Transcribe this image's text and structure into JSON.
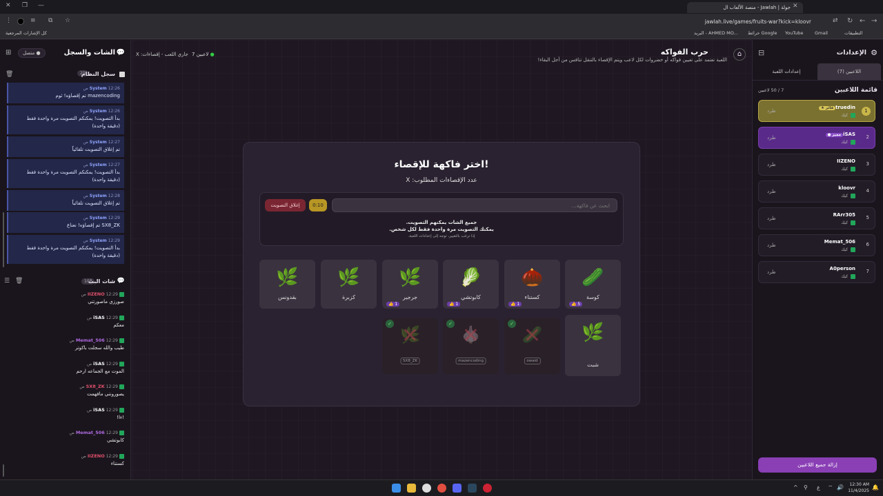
{
  "browser": {
    "tab_title": "جولة | Jawlah - منصة الألعاب ال",
    "url": "jawlah.live/games/fruits-war?kick=kloovr",
    "bookmarks": [
      "التطبيقات",
      "Gmail",
      "YouTube",
      "خرائط Google",
      "البريد - AHMED MO...",
      "كل الإشارات المرجعية"
    ]
  },
  "chat_panel": {
    "title": "الشات والسجل",
    "status": "متصل",
    "system_log": {
      "title": "سجل النظام",
      "count": "25",
      "messages": [
        {
          "sender": "System",
          "time": "12:26 ص",
          "text": "mazencoding تم إقصاؤه! ثوم"
        },
        {
          "sender": "System",
          "time": "12:26 ص",
          "text": "بدأ التصويت! يمكنكم التصويت مرة واحدة فقط (دقيقة واحدة)"
        },
        {
          "sender": "System",
          "time": "12:27 ص",
          "text": "تم إغلاق التصويت تلقائياً"
        },
        {
          "sender": "System",
          "time": "12:27 ص",
          "text": "بدأ التصويت! يمكنكم التصويت مرة واحدة فقط (دقيقة واحدة)"
        },
        {
          "sender": "System",
          "time": "12:28 ص",
          "text": "تم إغلاق التصويت تلقائياً"
        },
        {
          "sender": "System",
          "time": "12:29 ص",
          "text": "SX8_ZK تم إقصاؤه! نعناع"
        },
        {
          "sender": "System",
          "time": "12:29 ص",
          "text": "بدأ التصويت! يمكنكم التصويت مرة واحدة فقط (دقيقة واحدة)"
        }
      ]
    },
    "live_chat": {
      "title": "شات البث",
      "count": "107",
      "messages": [
        {
          "user": "IIZENO",
          "color": "#e0506a",
          "time": "12:29 ص",
          "text": "صورزي ماصورتني"
        },
        {
          "user": "iSAS",
          "color": "#ffffff",
          "time": "12:29 ص",
          "text": "معكم"
        },
        {
          "user": "Memat_506",
          "color": "#b06ae0",
          "time": "12:29 ص",
          "text": "طيب والله سجلت باكوتر"
        },
        {
          "user": "iSAS",
          "color": "#ffffff",
          "time": "12:29 ص",
          "text": "الموت مع الجماعه ارحم"
        },
        {
          "user": "SX8_ZK",
          "color": "#e0506a",
          "time": "12:29 ص",
          "text": "يصورونني مافهمت"
        },
        {
          "user": "iSAS",
          "color": "#ffffff",
          "time": "12:29 ص",
          "text": "!ءا!"
        },
        {
          "user": "Memat_506",
          "color": "#b06ae0",
          "time": "12:29 ص",
          "text": "كابوتشي"
        },
        {
          "user": "IIZENO",
          "color": "#e0506a",
          "time": "12:29 ص",
          "text": "كستناء"
        }
      ]
    }
  },
  "header": {
    "title": "حرب الفواكه",
    "description": "اللعبة تعتمد على تعيين فواكه أو خضروات لكل لاعب ويتم الإقصاء بالتنقل تنافس من أجل البقاء!",
    "players_badge": "7 لاعبين",
    "status": "جاري اللعب - إقصاءات: X"
  },
  "game": {
    "title": "اختر فاكهة للإقصاء!",
    "required": "عدد الإقصاءات المطلوب: X",
    "search_placeholder": "ابحث عن فاكهة...",
    "timer": "0:10",
    "close_vote": "إغلاق التصويت",
    "info_line1": "جميع الشات يمكنهم التصويت.",
    "info_line2": "يمكنك التصويت مرة واحدة فقط لكل شخص.",
    "info_line3": "إذا ترغب بالتغيير، توجه إلى إعدادات اللعبة.",
    "fruits": [
      {
        "name": "كوسة",
        "icon": "🥒",
        "votes": "5"
      },
      {
        "name": "كستناء",
        "icon": "🌰",
        "votes": "1"
      },
      {
        "name": "كابوتشي",
        "icon": "🥬",
        "votes": "1"
      },
      {
        "name": "جرجير",
        "icon": "🌿",
        "votes": "1"
      },
      {
        "name": "كزبرة",
        "icon": "🌿",
        "votes": ""
      },
      {
        "name": "بقدونس",
        "icon": "🌿",
        "votes": ""
      },
      {
        "name": "شبت",
        "icon": "🌿",
        "votes": ""
      }
    ],
    "eliminated": [
      {
        "icon": "🥒",
        "player": "owaid"
      },
      {
        "icon": "🧄",
        "player": "mazencoding"
      },
      {
        "icon": "🌿",
        "player": "SX8_ZK"
      }
    ]
  },
  "settings": {
    "title": "الإعدادات",
    "tabs": [
      "اللاعبين (7)",
      "إعدادات اللعبة"
    ],
    "list_title": "قائمة اللاعبين",
    "count": "7 / 50 لاعبين",
    "kick_label": "طرد",
    "players": [
      {
        "num": "1",
        "name": "truedin",
        "tag": "★ فائز",
        "status": "كيك"
      },
      {
        "num": "2",
        "name": "iSAS",
        "tag": "● مميز",
        "status": "كيك"
      },
      {
        "num": "3",
        "name": "IIZENO",
        "tag": "",
        "status": "كيك"
      },
      {
        "num": "4",
        "name": "kloovr",
        "tag": "",
        "status": "كيك"
      },
      {
        "num": "5",
        "name": "RArr305",
        "tag": "",
        "status": "كيك"
      },
      {
        "num": "6",
        "name": "Memat_506",
        "tag": "",
        "status": "كيك"
      },
      {
        "num": "7",
        "name": "A0person",
        "tag": "",
        "status": "كيك"
      }
    ],
    "remove_all": "إزالة جميع اللاعبين"
  },
  "taskbar": {
    "time": "12:30 AM",
    "date": "11/4/2025",
    "lang": "ع"
  }
}
